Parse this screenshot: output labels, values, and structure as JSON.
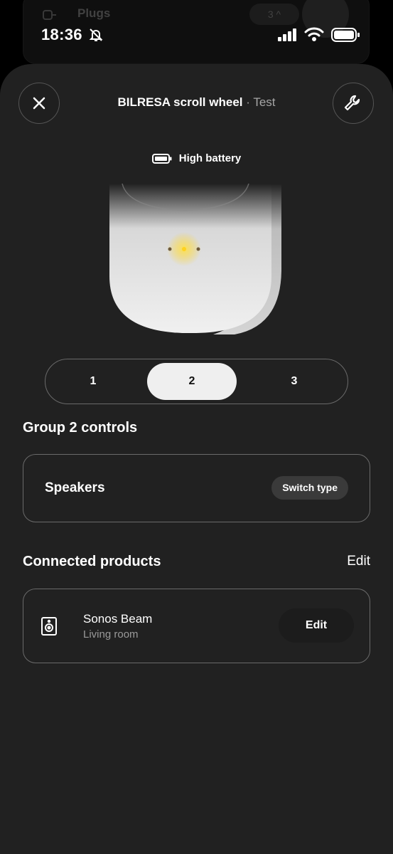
{
  "status_bar": {
    "time": "18:36",
    "icons": [
      "bell-slash-icon",
      "cellular-signal-icon",
      "wifi-icon",
      "battery-icon"
    ]
  },
  "background_app": {
    "label": "Plugs",
    "count": "3",
    "icons": [
      "plug-icon",
      "chevron-up-icon",
      "power-icon"
    ]
  },
  "header": {
    "device_name": "BILRESA scroll wheel",
    "separator": "·",
    "room": "Test",
    "close_icon": "close-icon",
    "settings_icon": "wrench-icon"
  },
  "battery": {
    "label": "High battery",
    "icon": "battery-icon"
  },
  "group_selector": {
    "options": [
      "1",
      "2",
      "3"
    ],
    "selected": "2"
  },
  "group_controls": {
    "title": "Group 2 controls",
    "type_label": "Speakers",
    "switch_label": "Switch type"
  },
  "connected_products": {
    "title": "Connected products",
    "edit_label": "Edit",
    "items": [
      {
        "name": "Sonos Beam",
        "room": "Living room",
        "icon": "speaker-icon",
        "edit_label": "Edit"
      }
    ]
  },
  "colors": {
    "background": "#000000",
    "sheet": "#212121",
    "border": "#6a6a6a",
    "selected_segment": "#efefef",
    "led": "#ffd21f"
  }
}
